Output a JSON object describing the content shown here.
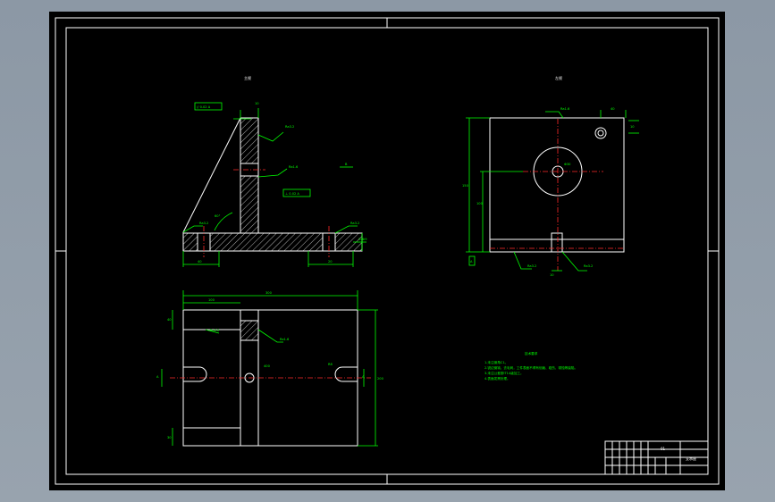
{
  "views": {
    "front": {
      "label": "主视"
    },
    "side": {
      "label": "左视"
    }
  },
  "dims": {
    "top_rect_h": "100",
    "top_rect_w": "96",
    "base_w_left": "40",
    "base_w_right": "20",
    "angle": "60°",
    "plan_w": "300",
    "plan_w_left": "100",
    "plan_h": "200",
    "hole_r": "R8",
    "side_w": "40",
    "side_hole": "Φ30",
    "side_h": "150"
  },
  "tech_notes": {
    "title": "技术要求",
    "lines": [
      "1.未注倒角C1。",
      "2.锐边倒钝，去毛刺，工件表面不得有划痕、碰伤、锈蚀等缺陷。",
      "3.未注公差按IT14级加工。",
      "4.表面发黑处理。"
    ]
  },
  "title_block": {
    "part_name": "支承座",
    "drawing_no": "01"
  }
}
